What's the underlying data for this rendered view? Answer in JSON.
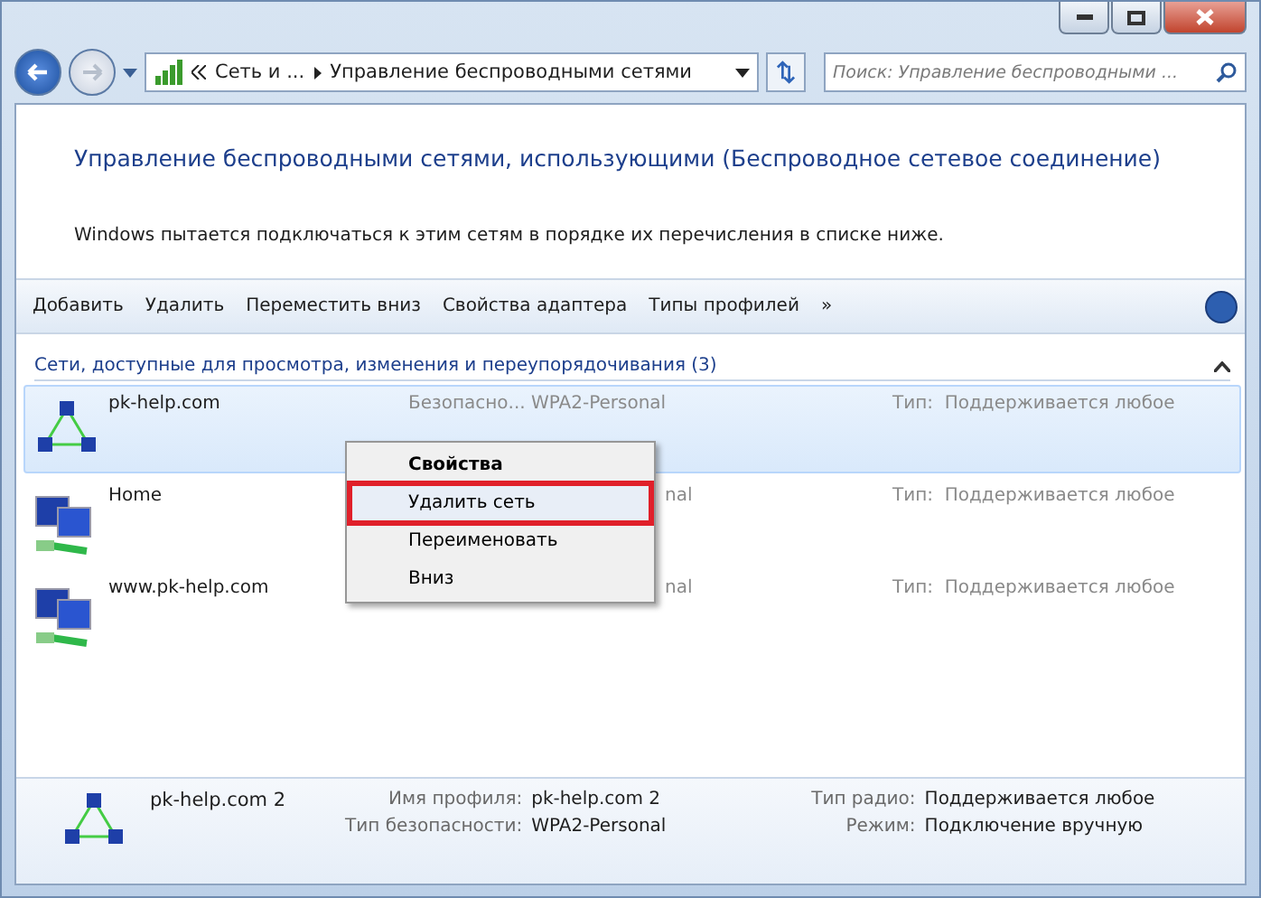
{
  "nav": {
    "breadcrumb": [
      "Сеть и ...",
      "Управление беспроводными сетями"
    ],
    "search": {
      "placeholder": "Поиск: Управление беспроводными ..."
    }
  },
  "heading": "Управление беспроводными сетями, использующими (Беспроводное сетевое соединение)",
  "description": "Windows пытается подключаться к этим сетям в порядке их перечисления в списке ниже.",
  "toolbar": [
    "Добавить",
    "Удалить",
    "Переместить вниз",
    "Свойства адаптера",
    "Типы профилей",
    "»"
  ],
  "group": {
    "title": "Сети, доступные для просмотра, изменения и переупорядочивания (3)",
    "expanded": true
  },
  "networks": [
    {
      "name": "pk-help.com",
      "security": "Безопасно... WPA2-Personal",
      "covered": false,
      "type_label": "Тип:",
      "type": "Поддерживается любое",
      "selected": true
    },
    {
      "name": "Home",
      "security": "nal",
      "covered": true,
      "type_label": "Тип:",
      "type": "Поддерживается любое",
      "selected": false
    },
    {
      "name": "www.pk-help.com",
      "security": "nal",
      "covered": true,
      "type_label": "Тип:",
      "type": "Поддерживается любое",
      "selected": false
    }
  ],
  "context_menu": [
    {
      "label": "Свойства",
      "bold": true,
      "selected": false
    },
    {
      "label": "Удалить сеть",
      "bold": false,
      "selected": true
    },
    {
      "label": "Переименовать",
      "bold": false,
      "selected": false
    },
    {
      "label": "Вниз",
      "bold": false,
      "selected": false
    }
  ],
  "details": {
    "name": "pk-help.com 2",
    "fields": [
      {
        "label": "Имя профиля:",
        "value": "pk-help.com 2"
      },
      {
        "label": "Тип радио:",
        "value": "Поддерживается любое"
      },
      {
        "label": "Тип безопасности:",
        "value": "WPA2-Personal"
      },
      {
        "label": "Режим:",
        "value": "Подключение вручную"
      }
    ]
  }
}
